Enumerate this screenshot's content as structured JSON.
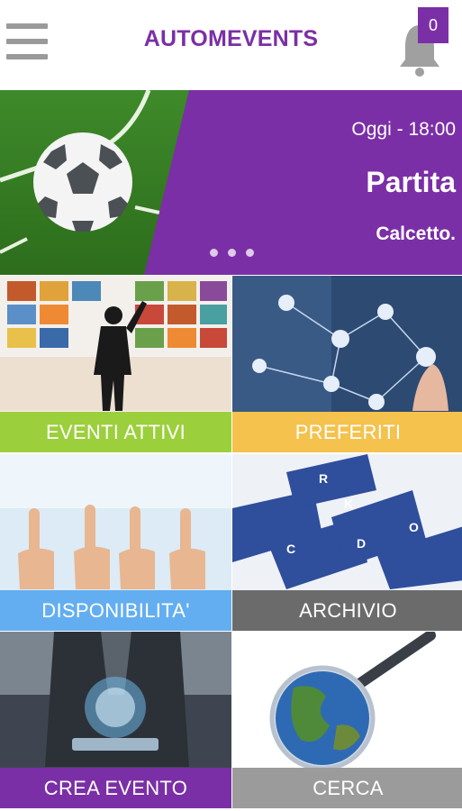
{
  "app": {
    "title": "AUTOMEVENTS",
    "accent_color": "#7b2fa6"
  },
  "header": {
    "menu_icon": "hamburger-menu-icon",
    "notification_icon": "bell-icon",
    "notification_count": "0"
  },
  "slider": {
    "date": "Oggi - 18:00",
    "title": "Partita",
    "subtitle": "Calcetto.",
    "image_icon": "soccer-ball-on-field",
    "dot_count": 3
  },
  "tiles": [
    {
      "label": "EVENTI ATTIVI",
      "color": "#9ccf3c",
      "image": "person-before-screen-wall"
    },
    {
      "label": "PREFERITI",
      "color": "#f4c24d",
      "image": "social-network-touch"
    },
    {
      "label": "DISPONIBILITA'",
      "color": "#63aef0",
      "image": "raised-index-fingers"
    },
    {
      "label": "ARCHIVIO",
      "color": "#6b6b6b",
      "image": "file-index-cards"
    },
    {
      "label": "CREA EVENTO",
      "color": "#7b2fa6",
      "image": "businessman-hologram-tablet"
    },
    {
      "label": "CERCA",
      "color": "#9b9b9b",
      "image": "magnifier-earth"
    }
  ]
}
